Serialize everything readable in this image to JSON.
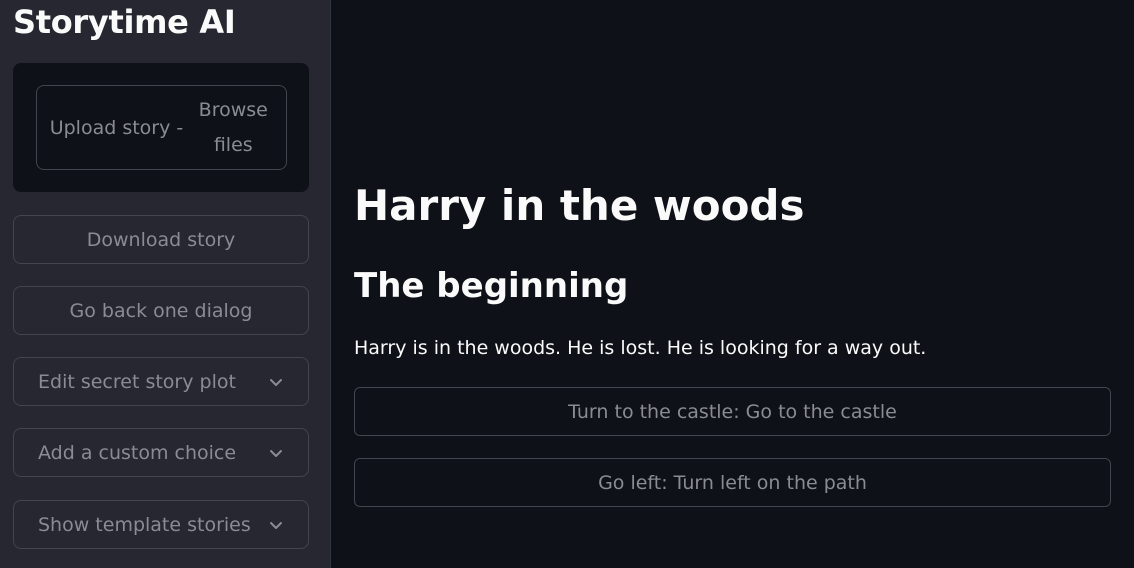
{
  "sidebar": {
    "app_title": "Storytime AI",
    "upload": {
      "label": "Upload story -",
      "browse_line1": "Browse",
      "browse_line2": "files"
    },
    "download_label": "Download story",
    "go_back_label": "Go back one dialog",
    "expanders": [
      {
        "label": "Edit secret story plot",
        "icon": "chevron-down-icon"
      },
      {
        "label": "Add a custom choice",
        "icon": "chevron-down-icon"
      },
      {
        "label": "Show template stories",
        "icon": "chevron-down-icon"
      }
    ]
  },
  "main": {
    "story_title": "Harry in the woods",
    "chapter_title": "The beginning",
    "story_text": "Harry is in the woods. He is lost. He is looking for a way out.",
    "choices": [
      {
        "label": "Turn to the castle: Go to the castle"
      },
      {
        "label": "Go left: Turn left on the path"
      }
    ]
  },
  "colors": {
    "background": "#0e1117",
    "sidebar": "#262730",
    "text": "#fafafa",
    "muted_text": "#8a8c93",
    "border": "#42444e"
  }
}
